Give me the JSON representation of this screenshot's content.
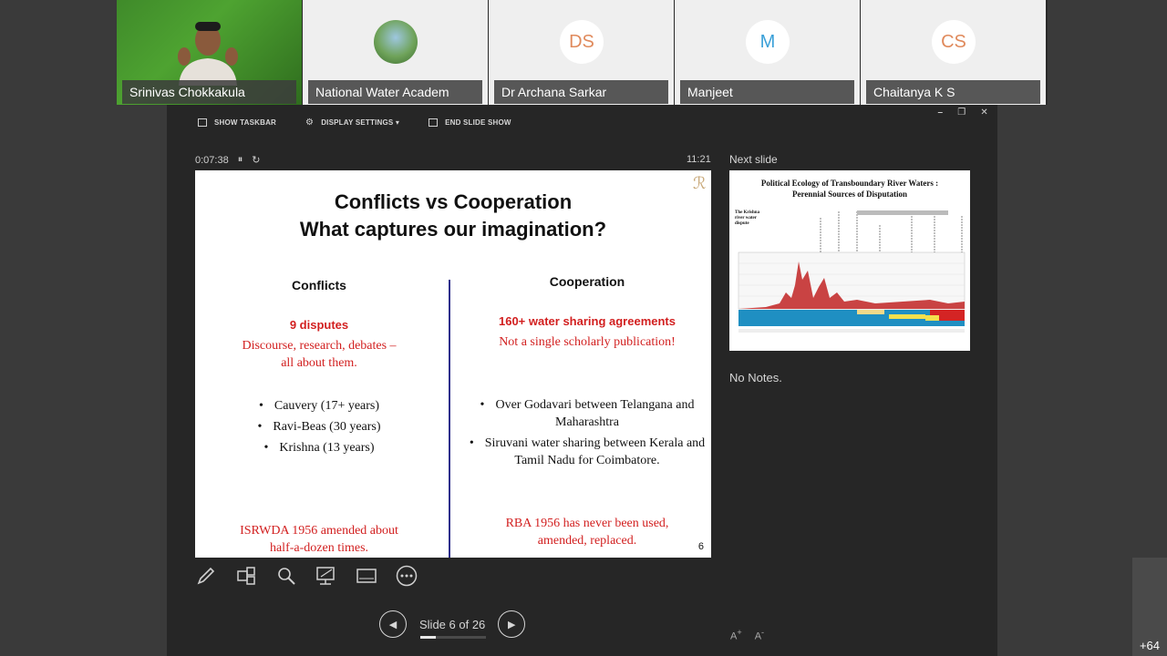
{
  "participants": [
    {
      "name": "Srinivas Chokkakula",
      "type": "video"
    },
    {
      "name": "National Water Academ",
      "type": "photo"
    },
    {
      "name": "Dr Archana Sarkar",
      "initials": "DS"
    },
    {
      "name": "Manjeet",
      "initials": "M"
    },
    {
      "name": "Chaitanya K S",
      "initials": "CS"
    }
  ],
  "toolbar": {
    "show_taskbar": "SHOW TASKBAR",
    "display_settings": "DISPLAY SETTINGS ▾",
    "end_slide_show": "END SLIDE SHOW"
  },
  "timer": "0:07:38",
  "clock": "11:21",
  "slide": {
    "title_line1": "Conflicts vs Cooperation",
    "title_line2": "What captures our imagination?",
    "left": {
      "heading": "Conflicts",
      "highlight": "9 disputes",
      "text1": "Discourse, research, debates –",
      "text2": "all about them.",
      "bullets": [
        "Cauvery (17+ years)",
        "Ravi-Beas (30 years)",
        "Krishna (13 years)"
      ],
      "footer1": "ISRWDA 1956 amended about",
      "footer2": "half-a-dozen times."
    },
    "right": {
      "heading": "Cooperation",
      "highlight": "160+ water sharing agreements",
      "text1": "Not a single scholarly publication!",
      "bullets": [
        "Over Godavari between Telangana and Maharashtra",
        "Siruvani water sharing between Kerala and Tamil Nadu for Coimbatore."
      ],
      "footer1": "RBA 1956 has never been used,",
      "footer2": "amended, replaced."
    },
    "number": "6"
  },
  "next_slide": {
    "label": "Next slide",
    "title_line1": "Political Ecology of Transboundary River Waters :",
    "title_line2": "Perennial Sources of Disputation",
    "side_label": "The Krishna river water dispute"
  },
  "notes": "No Notes.",
  "navigation": {
    "slide_indicator": "Slide 6 of 26",
    "progress": 0.23
  },
  "overflow_count": "+64"
}
